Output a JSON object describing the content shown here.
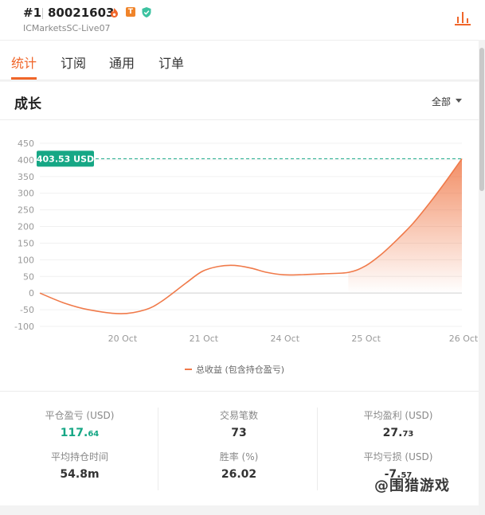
{
  "header": {
    "rank": "#1",
    "account_id": "80021603",
    "badge_t": "T",
    "server": "ICMarketsSC-Live07"
  },
  "tabs": [
    {
      "label": "统计",
      "active": true
    },
    {
      "label": "订阅",
      "active": false
    },
    {
      "label": "通用",
      "active": false
    },
    {
      "label": "订单",
      "active": false
    }
  ],
  "growth": {
    "title": "成长",
    "filter_label": "全部"
  },
  "colors": {
    "accent": "#f0662a",
    "line": "#f07a4a",
    "marker": "#16a785",
    "positive": "#16a785"
  },
  "chart_data": {
    "type": "area",
    "y_ticks": [
      "450",
      "400",
      "350",
      "300",
      "250",
      "200",
      "150",
      "100",
      "50",
      "0",
      "-50",
      "-100"
    ],
    "ylim": [
      -100,
      450
    ],
    "x_tick_labels": [
      "20 Oct",
      "21 Oct",
      "24 Oct",
      "25 Oct",
      "26 Oct"
    ],
    "series": [
      {
        "name": "总收益 (包含持仓盈亏)",
        "points": [
          [
            0,
            0
          ],
          [
            0.3,
            -30
          ],
          [
            0.6,
            -50
          ],
          [
            1.0,
            -62
          ],
          [
            1.3,
            -50
          ],
          [
            1.5,
            -25
          ],
          [
            1.8,
            30
          ],
          [
            2.0,
            65
          ],
          [
            2.2,
            80
          ],
          [
            2.4,
            83
          ],
          [
            2.6,
            75
          ],
          [
            2.8,
            62
          ],
          [
            3.0,
            55
          ],
          [
            3.2,
            55
          ],
          [
            3.5,
            58
          ],
          [
            3.8,
            62
          ],
          [
            4.0,
            80
          ],
          [
            4.2,
            115
          ],
          [
            4.4,
            160
          ],
          [
            4.6,
            210
          ],
          [
            4.8,
            270
          ],
          [
            5.0,
            335
          ],
          [
            5.2,
            403.53
          ]
        ]
      }
    ],
    "x_tick_positions": [
      1,
      2,
      3,
      4,
      5.2
    ],
    "last_value_label": "403.53 USD",
    "grid": true
  },
  "stats": [
    {
      "label": "平仓盈亏 (USD)",
      "int": "117.",
      "dec": "64",
      "positive": true
    },
    {
      "label": "交易笔数",
      "int": "73",
      "dec": "",
      "positive": false
    },
    {
      "label": "平均盈利 (USD)",
      "int": "27.",
      "dec": "73",
      "positive": false
    },
    {
      "label": "平均持仓时间",
      "int": "54.8m",
      "dec": "",
      "positive": false
    },
    {
      "label": "胜率 (%)",
      "int": "26.02",
      "dec": "",
      "positive": false
    },
    {
      "label": "平均亏损 (USD)",
      "int": "-7.",
      "dec": "57",
      "positive": false
    }
  ],
  "watermark": "@围猎游戏"
}
